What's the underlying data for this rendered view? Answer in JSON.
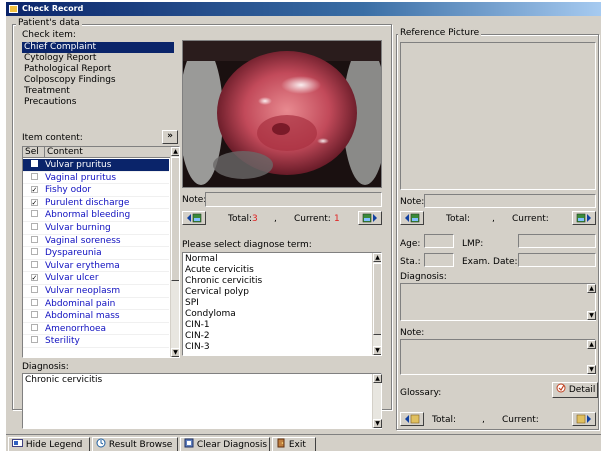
{
  "window": {
    "title": "Check Record"
  },
  "patient_group": {
    "label": "Patient's data"
  },
  "check_item": {
    "label": "Check item:",
    "items": [
      "Chief Complaint",
      "Cytology Report",
      "Pathological Report",
      "Colposcopy Findings",
      "Treatment",
      "Precautions"
    ],
    "selected": 0
  },
  "item_content": {
    "label": "Item content:",
    "expand_button": "»",
    "col_sel": "Sel",
    "col_content": "Content",
    "rows": [
      {
        "text": "Vulvar pruritus",
        "checked": false,
        "selected": true
      },
      {
        "text": "Vaginal pruritus",
        "checked": false,
        "selected": false
      },
      {
        "text": "Fishy odor",
        "checked": true,
        "selected": false
      },
      {
        "text": "Purulent discharge",
        "checked": true,
        "selected": false
      },
      {
        "text": "Abnormal bleeding",
        "checked": false,
        "selected": false
      },
      {
        "text": "Vulvar burning",
        "checked": false,
        "selected": false
      },
      {
        "text": "Vaginal soreness",
        "checked": false,
        "selected": false
      },
      {
        "text": "Dyspareunia",
        "checked": false,
        "selected": false
      },
      {
        "text": "Vulvar erythema",
        "checked": false,
        "selected": false
      },
      {
        "text": "Vulvar ulcer",
        "checked": true,
        "selected": false
      },
      {
        "text": "Vulvar neoplasm",
        "checked": false,
        "selected": false
      },
      {
        "text": "Abdominal pain",
        "checked": false,
        "selected": false
      },
      {
        "text": "Abdominal mass",
        "checked": false,
        "selected": false
      },
      {
        "text": "Amenorrhoea",
        "checked": false,
        "selected": false
      },
      {
        "text": "Sterility",
        "checked": false,
        "selected": false
      }
    ]
  },
  "image_panel": {
    "note_label": "Note:",
    "total_label": "Total:",
    "total_value": "3",
    "comma": ",",
    "current_label": "Current:",
    "current_value": "1"
  },
  "diagnose_term": {
    "label": "Please select diagnose term:",
    "items": [
      "Normal",
      "Acute cervicitis",
      "Chronic cervicitis",
      "Cervical polyp",
      "SPI",
      "Condyloma",
      "CIN-1",
      "CIN-2",
      "CIN-3"
    ]
  },
  "diagnosis": {
    "label": "Diagnosis:",
    "value": "Chronic cervicitis"
  },
  "reference": {
    "group_label": "Reference Picture",
    "note_label": "Note:",
    "total_label": "Total:",
    "comma": ",",
    "current_label": "Current:",
    "age_label": "Age:",
    "lmp_label": "LMP:",
    "sta_label": "Sta.:",
    "exam_date_label": "Exam. Date:",
    "diagnosis_label": "Diagnosis:",
    "note2_label": "Note:",
    "glossary_label": "Glossary:",
    "detail_button": "Detail",
    "bottom_total_label": "Total:",
    "bottom_comma": ",",
    "bottom_current_label": "Current:"
  },
  "toolbar": {
    "hide_legend": "Hide Legend",
    "result_browse": "Result Browse",
    "clear_diagnosis": "Clear Diagnosis",
    "exit": "Exit"
  },
  "colors": {
    "title_bar": "#0a246a",
    "selection": "#0a246a",
    "link_text": "#1010c0",
    "count_red": "#e02020",
    "face": "#d4d0c8"
  }
}
